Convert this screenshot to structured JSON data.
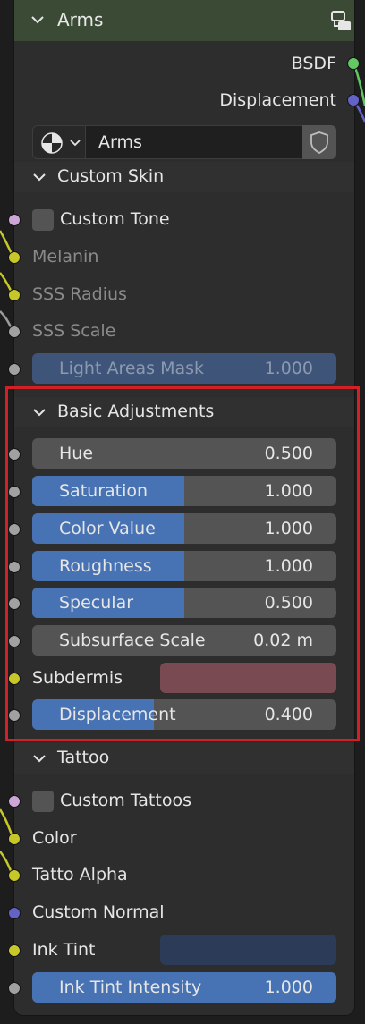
{
  "node": {
    "title": "Arms",
    "outputs": {
      "bsdf": "BSDF",
      "displacement": "Displacement"
    },
    "material": {
      "name": "Arms"
    }
  },
  "custom_skin": {
    "title": "Custom Skin",
    "custom_tone": "Custom Tone",
    "melanin": "Melanin",
    "sss_radius": "SSS Radius",
    "sss_scale": "SSS Scale",
    "light_areas_mask": {
      "label": "Light Areas Mask",
      "value": "1.000"
    }
  },
  "basic_adjustments": {
    "title": "Basic Adjustments",
    "sliders": [
      {
        "label": "Hue",
        "value": "0.500",
        "fraction": 0.0
      },
      {
        "label": "Saturation",
        "value": "1.000",
        "fraction": 0.5
      },
      {
        "label": "Color Value",
        "value": "1.000",
        "fraction": 0.5
      },
      {
        "label": "Roughness",
        "value": "1.000",
        "fraction": 0.5
      },
      {
        "label": "Specular",
        "value": "0.500",
        "fraction": 0.5
      },
      {
        "label": "Subsurface Scale",
        "value": "0.02 m",
        "fraction": 0.0
      }
    ],
    "subdermis": {
      "label": "Subdermis",
      "color": "#7a4a52"
    },
    "displacement": {
      "label": "Displacement",
      "value": "0.400",
      "fraction": 0.4
    }
  },
  "tattoo": {
    "title": "Tattoo",
    "custom_tattoos": "Custom Tattoos",
    "color": "Color",
    "tatto_alpha": "Tatto Alpha",
    "custom_normal": "Custom Normal",
    "ink_tint": {
      "label": "Ink Tint",
      "color": "#2c3c58"
    },
    "ink_tint_intensity": {
      "label": "Ink Tint Intensity",
      "value": "1.000",
      "fraction": 1.0
    }
  },
  "colors": {
    "header": "#3b4a35",
    "slider_fill": "#4772b3",
    "highlight_box": "#d32027"
  }
}
